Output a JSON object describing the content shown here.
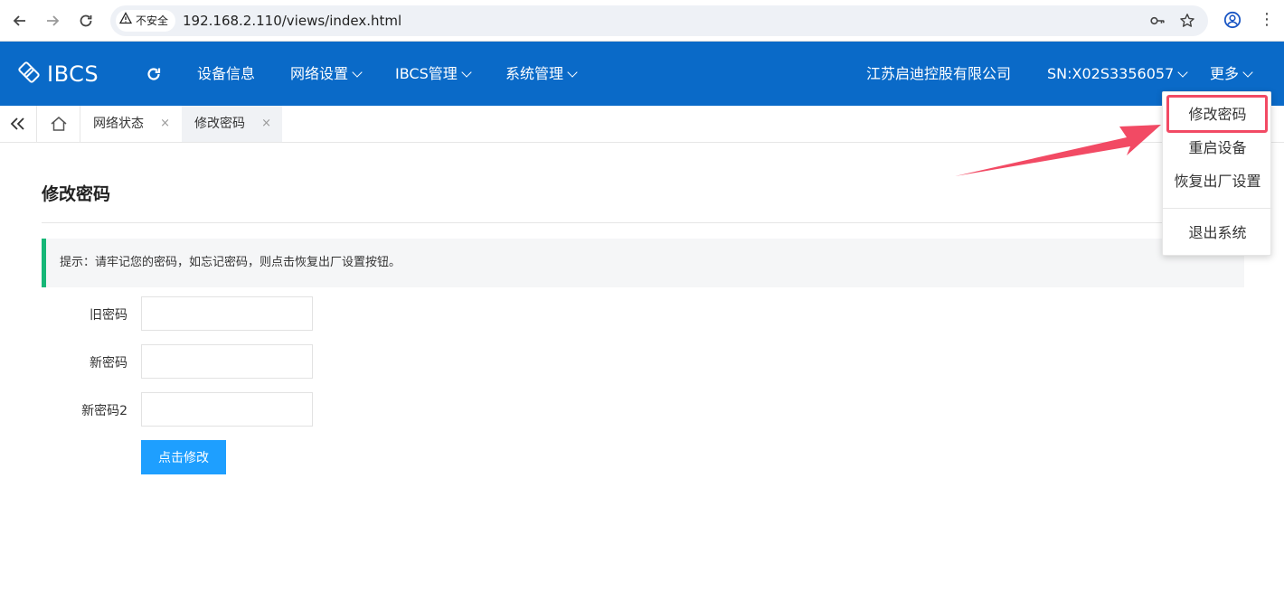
{
  "browser": {
    "security_label": "不安全",
    "url": "192.168.2.110/views/index.html",
    "icons": [
      "back-icon",
      "forward-icon",
      "reload-icon",
      "warning-icon",
      "key-icon",
      "star-icon",
      "profile-icon",
      "kebab-menu-icon"
    ]
  },
  "header": {
    "logo_text": "IBCS",
    "menu": [
      {
        "label": "设备信息",
        "has_caret": false
      },
      {
        "label": "网络设置",
        "has_caret": true
      },
      {
        "label": "IBCS管理",
        "has_caret": true
      },
      {
        "label": "系统管理",
        "has_caret": true
      }
    ],
    "company": "江苏启迪控股有限公司",
    "serial": "SN:X02S3356057",
    "more": "更多"
  },
  "tabs": [
    {
      "label": "网络状态",
      "active": false
    },
    {
      "label": "修改密码",
      "active": true
    }
  ],
  "tab_close_glyph": "×",
  "page": {
    "title": "修改密码",
    "tip": "提示：请牢记您的密码，如忘记密码，则点击恢复出厂设置按钮。",
    "fields": [
      {
        "label": "旧密码",
        "value": ""
      },
      {
        "label": "新密码",
        "value": ""
      },
      {
        "label": "新密码2",
        "value": ""
      }
    ],
    "submit_label": "点击修改"
  },
  "dropdown": {
    "items": [
      "修改密码",
      "重启设备",
      "恢复出厂设置",
      "退出系统"
    ],
    "highlighted": "修改密码"
  },
  "colors": {
    "header_bg": "#0a6ac8",
    "accent_green": "#16b777",
    "button_blue": "#1e9fff",
    "annotation_red": "#f24a64"
  }
}
